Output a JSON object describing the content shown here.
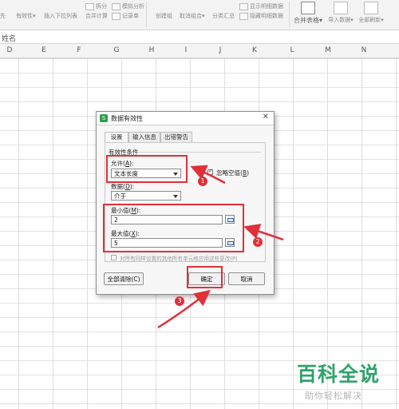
{
  "ribbon": {
    "items": [
      "有效性",
      "插入下拉列表",
      "合并计算",
      "记录单",
      "创建组",
      "取消组合",
      "分类汇总",
      "隐藏明细数据",
      "合并表格",
      "导入数据",
      "全部刷新"
    ],
    "small_items": [
      "拆分",
      "模拟分析",
      "显示明细数据"
    ],
    "merge_label": "合并表格"
  },
  "formula_bar": {
    "name_text": "姓名"
  },
  "columns": [
    "D",
    "E",
    "F",
    "G",
    "H",
    "I",
    "J",
    "K",
    "L",
    "M",
    "N"
  ],
  "dialog": {
    "title": "数据有效性",
    "tabs": [
      "设置",
      "输入信息",
      "出错警告"
    ],
    "group_label": "有效性条件",
    "allow_label": "允许(A):",
    "allow_label_main": "允许(",
    "allow_key": "A",
    "allow_tail": "):",
    "allow_value": "文本长度",
    "ignore_blank_label": "忽略空值(B)",
    "ignore_blank_main": "忽略空值(",
    "ignore_blank_key": "B",
    "ignore_blank_tail": ")",
    "ignore_blank_checked": true,
    "data_label_main": "数据(",
    "data_key": "D",
    "data_tail": "):",
    "data_value": "介于",
    "min_label_main": "最小值(",
    "min_key": "M",
    "min_tail": "):",
    "min_value": "2",
    "max_label_main": "最大值(",
    "max_key": "X",
    "max_tail": "):",
    "max_value": "5",
    "apply_all_label": "对所有同样设置的其他所有单元格应用这些更改(P)",
    "clear_all_button": "全部清除(C)",
    "ok_button": "确定",
    "cancel_button": "取消"
  },
  "annotations": {
    "badge1": "1",
    "badge2": "2",
    "badge3": "3",
    "color": "#e0303a"
  },
  "watermark": {
    "main": "百科全说",
    "sub": "助你轻松解决"
  }
}
